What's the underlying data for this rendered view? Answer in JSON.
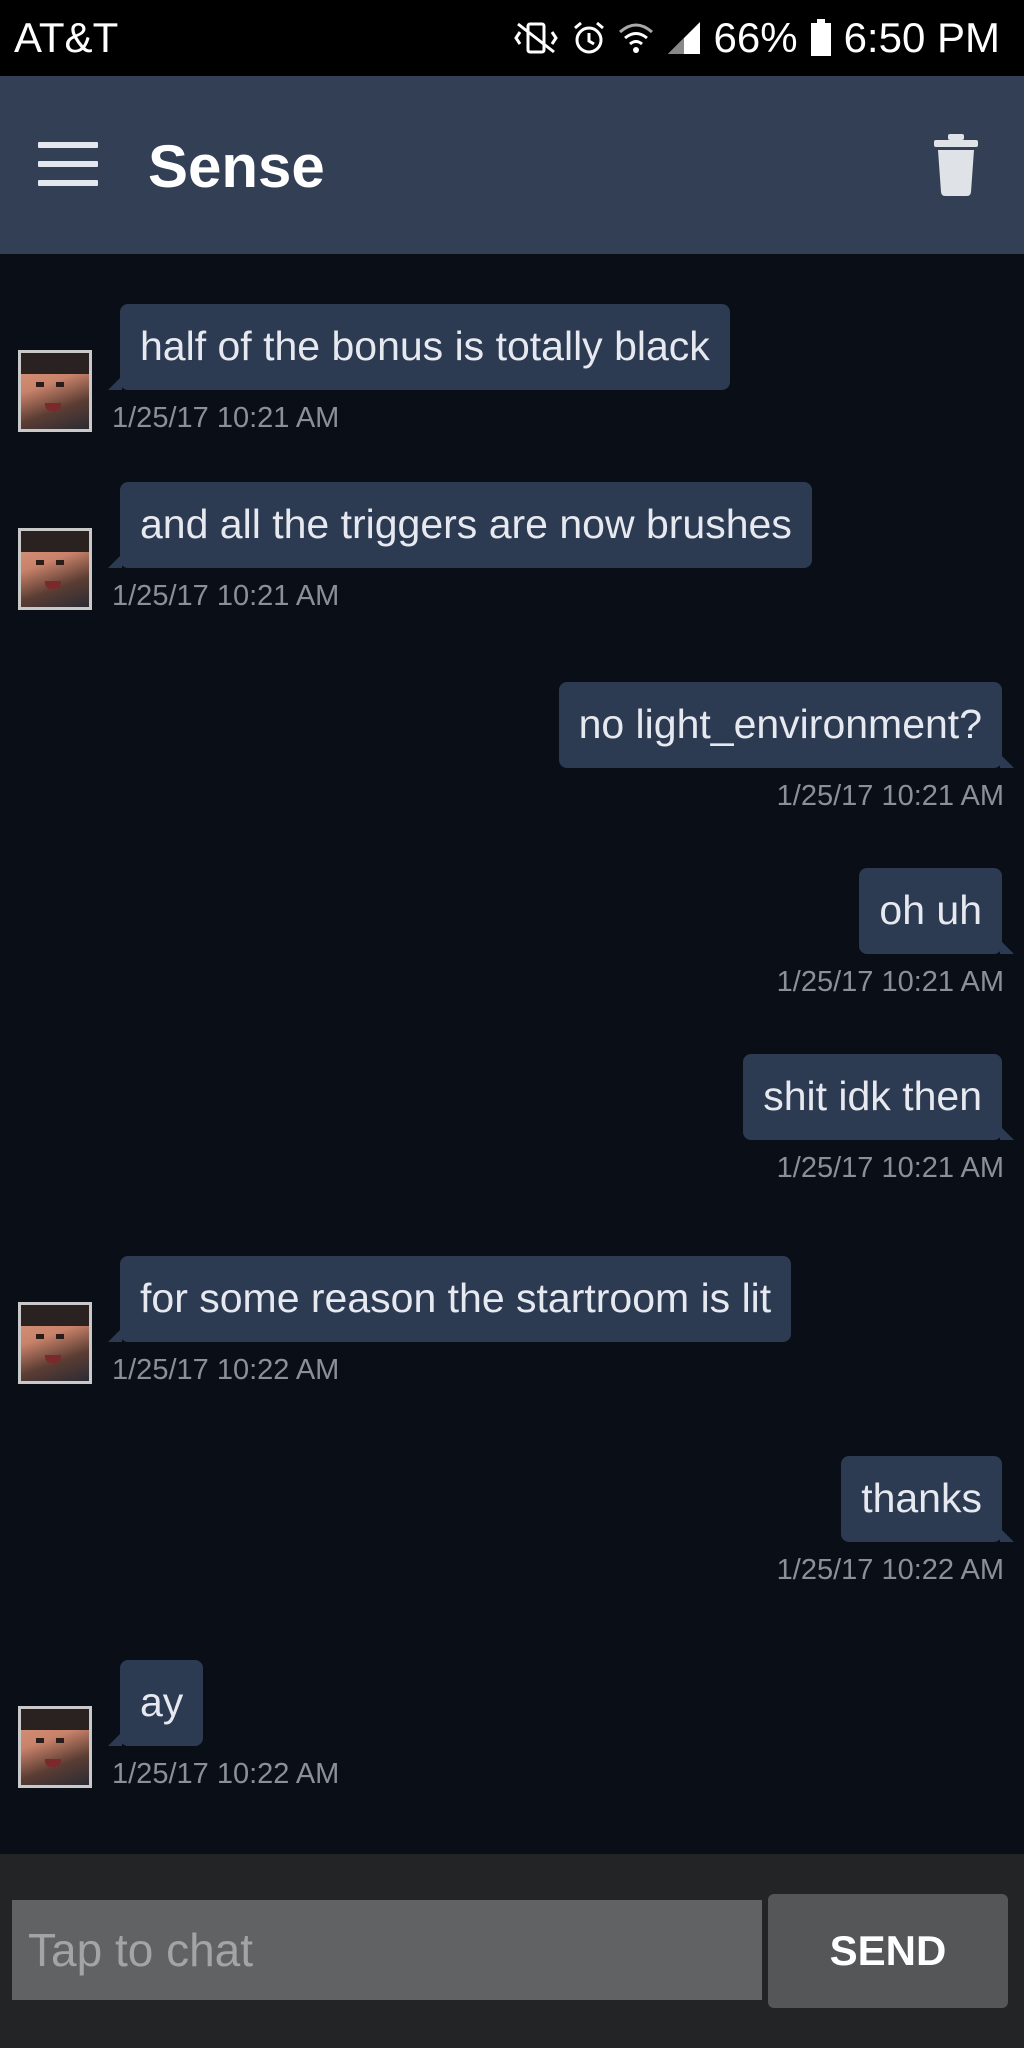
{
  "status_bar": {
    "carrier": "AT&T",
    "battery": "66%",
    "time": "6:50 PM",
    "icons": [
      "mute-vibrate-icon",
      "alarm-icon",
      "wifi-icon",
      "signal-icon",
      "battery-icon"
    ]
  },
  "app_bar": {
    "title": "Sense",
    "left_icon": "hamburger-menu-icon",
    "right_icon": "trash-icon"
  },
  "messages": [
    {
      "side": "incoming",
      "text": "half of the bonus is totally black",
      "timestamp": "1/25/17 10:21 AM"
    },
    {
      "side": "incoming",
      "text": "and all the triggers are now brushes",
      "timestamp": "1/25/17 10:21 AM"
    },
    {
      "side": "outgoing",
      "text": "no light_environment?",
      "timestamp": "1/25/17 10:21 AM"
    },
    {
      "side": "outgoing",
      "text": "oh uh",
      "timestamp": "1/25/17 10:21 AM"
    },
    {
      "side": "outgoing",
      "text": "shit idk then",
      "timestamp": "1/25/17 10:21 AM"
    },
    {
      "side": "incoming",
      "text": "for some reason the startroom is lit",
      "timestamp": "1/25/17 10:22 AM"
    },
    {
      "side": "outgoing",
      "text": "thanks",
      "timestamp": "1/25/17 10:22 AM"
    },
    {
      "side": "incoming",
      "text": "ay",
      "timestamp": "1/25/17 10:22 AM"
    }
  ],
  "composer": {
    "placeholder": "Tap to chat",
    "send_label": "SEND"
  },
  "colors": {
    "status_bar": "#000000",
    "app_bar": "#323f55",
    "chat_background": "#0a0f17",
    "bubble": "#2c3a52",
    "timestamp": "#8a8f98",
    "bottom_bar": "#222426",
    "send_button": "#545658"
  }
}
